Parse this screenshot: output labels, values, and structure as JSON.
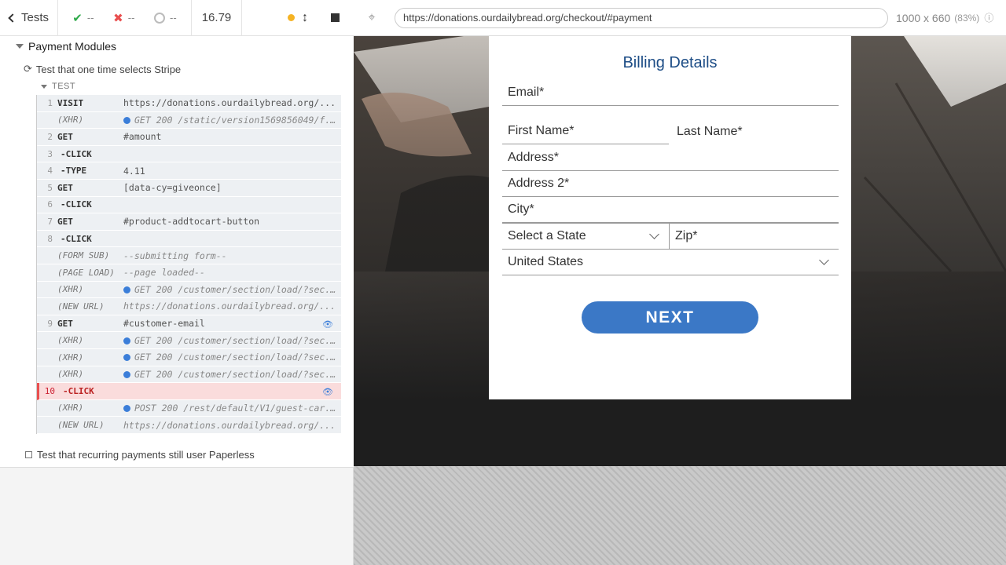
{
  "reporter": {
    "tests_label": "Tests",
    "passed": "--",
    "failed": "--",
    "pending": "--",
    "duration": "16.79",
    "suite_title": "Payment Modules",
    "test1_title": "Test that one time selects Stripe",
    "hook_label": "TEST",
    "test2_title": "Test that recurring payments still user Paperless",
    "commands": [
      {
        "num": "1",
        "name": "VISIT",
        "msg": "https://donations.ourdailybread.org/...",
        "kind": "cmd"
      },
      {
        "num": "",
        "name": "(XHR)",
        "msg": "GET 200 /static/version1569856049/f...",
        "kind": "xhr"
      },
      {
        "num": "2",
        "name": "GET",
        "msg": "#amount",
        "kind": "cmd"
      },
      {
        "num": "3",
        "name": "-CLICK",
        "msg": "",
        "kind": "sub"
      },
      {
        "num": "4",
        "name": "-TYPE",
        "msg": "4.11",
        "kind": "sub"
      },
      {
        "num": "5",
        "name": "GET",
        "msg": "[data-cy=giveonce]",
        "kind": "cmd"
      },
      {
        "num": "6",
        "name": "-CLICK",
        "msg": "",
        "kind": "sub"
      },
      {
        "num": "7",
        "name": "GET",
        "msg": "#product-addtocart-button",
        "kind": "cmd"
      },
      {
        "num": "8",
        "name": "-CLICK",
        "msg": "",
        "kind": "sub"
      },
      {
        "num": "",
        "name": "(FORM SUB)",
        "msg": "--submitting form--",
        "kind": "evt"
      },
      {
        "num": "",
        "name": "(PAGE LOAD)",
        "msg": "--page loaded--",
        "kind": "evt"
      },
      {
        "num": "",
        "name": "(XHR)",
        "msg": "GET 200 /customer/section/load/?sec...",
        "kind": "xhr"
      },
      {
        "num": "",
        "name": "(NEW URL)",
        "msg": "https://donations.ourdailybread.org/...",
        "kind": "evt"
      },
      {
        "num": "9",
        "name": "GET",
        "msg": "#customer-email",
        "kind": "cmd",
        "eye": true
      },
      {
        "num": "",
        "name": "(XHR)",
        "msg": "GET 200 /customer/section/load/?sec...",
        "kind": "xhr"
      },
      {
        "num": "",
        "name": "(XHR)",
        "msg": "GET 200 /customer/section/load/?sec...",
        "kind": "xhr"
      },
      {
        "num": "",
        "name": "(XHR)",
        "msg": "GET 200 /customer/section/load/?sec...",
        "kind": "xhr"
      },
      {
        "num": "10",
        "name": "-CLICK",
        "msg": "",
        "kind": "sub",
        "failed": true,
        "eye": true
      },
      {
        "num": "",
        "name": "(XHR)",
        "msg": "POST 200 /rest/default/V1/guest-car...",
        "kind": "xhr"
      },
      {
        "num": "",
        "name": "(NEW URL)",
        "msg": "https://donations.ourdailybread.org/...",
        "kind": "evt"
      }
    ]
  },
  "aut": {
    "url": "https://donations.ourdailybread.org/checkout/#payment",
    "viewport": "1000 x 660",
    "scale": "(83%)"
  },
  "form": {
    "title": "Billing Details",
    "email": "Email*",
    "first_name": "First Name*",
    "last_name": "Last Name*",
    "address": "Address*",
    "address2": "Address 2*",
    "city": "City*",
    "state": "Select a State",
    "zip": "Zip*",
    "country": "United States",
    "next": "NEXT"
  },
  "colors": {
    "pass": "#2eaa4a",
    "fail": "#e94f4f",
    "accent": "#3b78c6",
    "title": "#1d4d86"
  }
}
